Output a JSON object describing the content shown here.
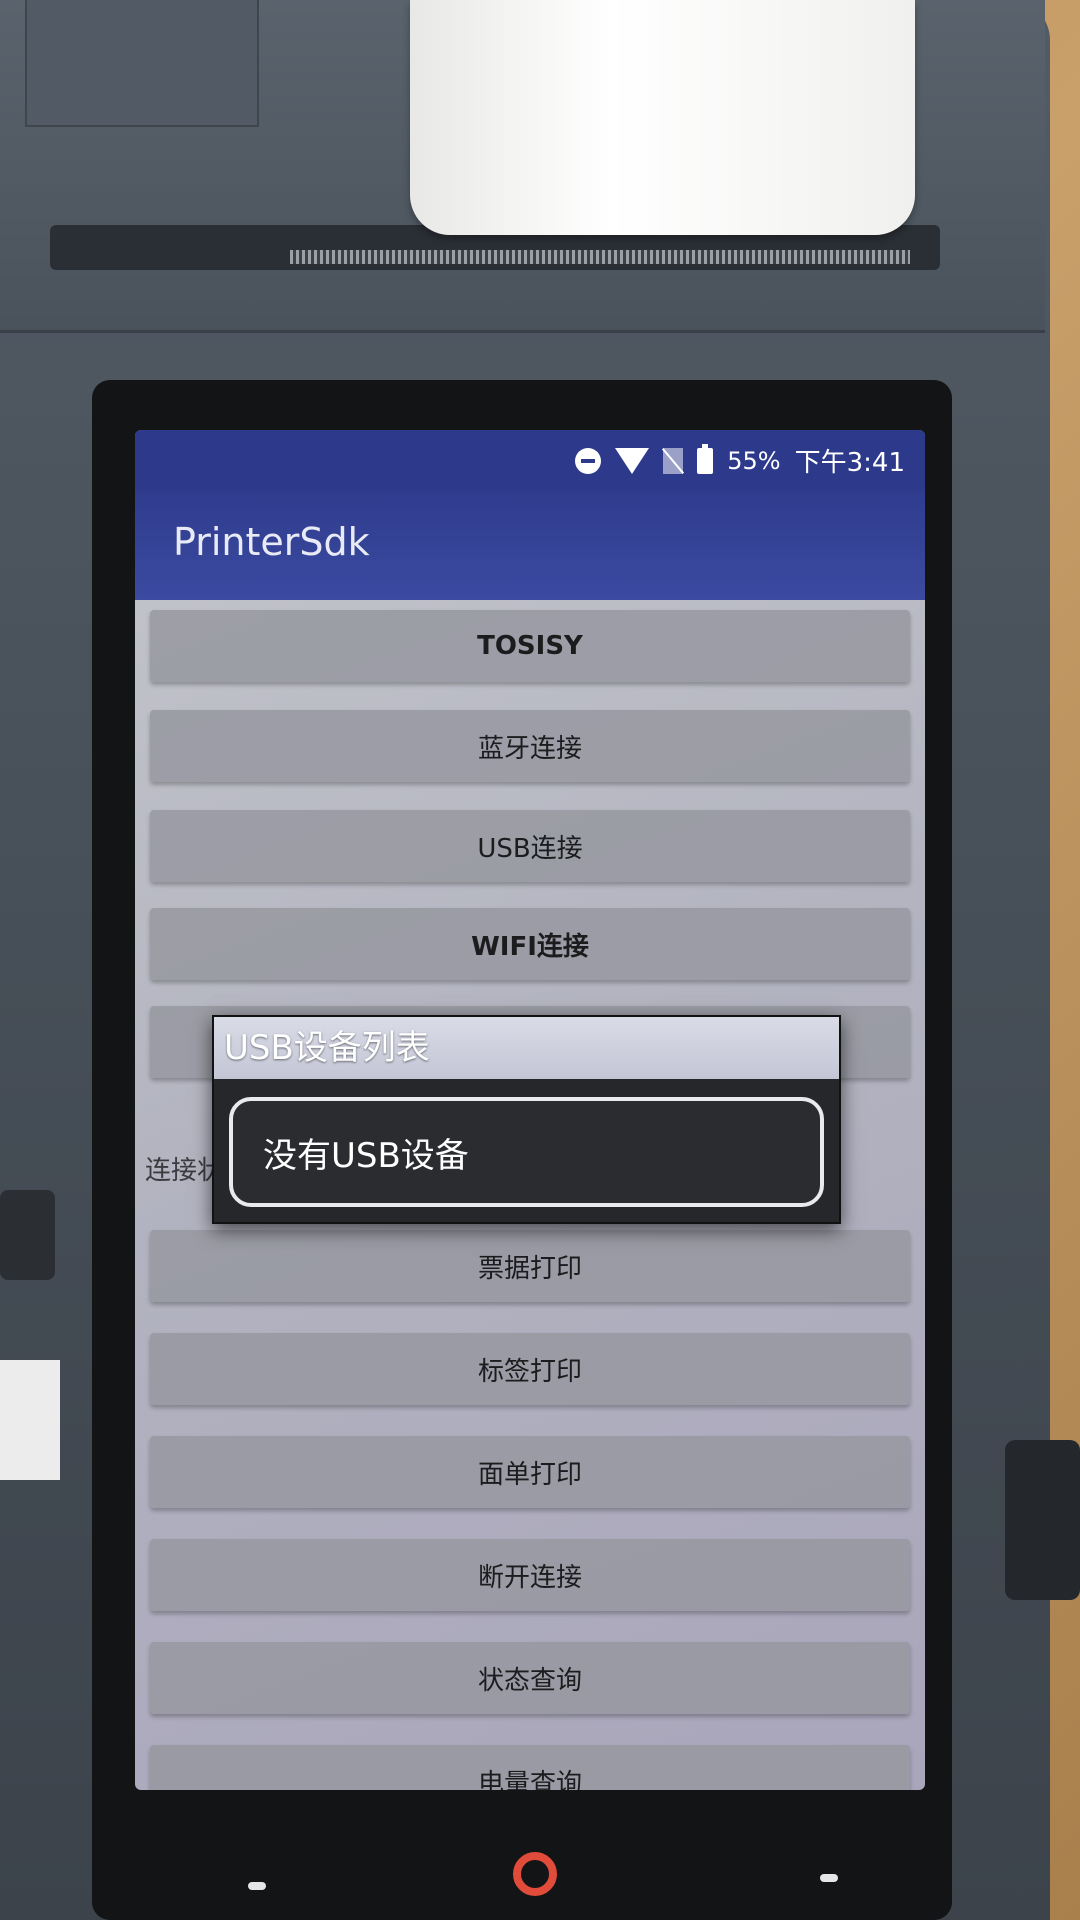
{
  "status_bar": {
    "battery": "55%",
    "time": "下午3:41",
    "icons": [
      "do-not-disturb-icon",
      "wifi-icon",
      "no-sim-icon",
      "battery-icon"
    ]
  },
  "app_bar": {
    "title": "PrinterSdk"
  },
  "buttons": [
    {
      "label": "TOSISY"
    },
    {
      "label": "蓝牙连接"
    },
    {
      "label": "USB连接"
    },
    {
      "label": "WIFI连接"
    },
    {
      "label": ""
    },
    {
      "label": "票据打印"
    },
    {
      "label": "标签打印"
    },
    {
      "label": "面单打印"
    },
    {
      "label": "断开连接"
    },
    {
      "label": "状态查询"
    },
    {
      "label": "电量查询"
    }
  ],
  "connect_status_label": "连接状",
  "dialog": {
    "title": "USB设备列表",
    "item": "没有USB设备"
  },
  "colors": {
    "app_bar": "#2f3c8e",
    "button": "#96989f",
    "dialog_bg": "#25272a",
    "home_accent": "#e04b3a"
  }
}
